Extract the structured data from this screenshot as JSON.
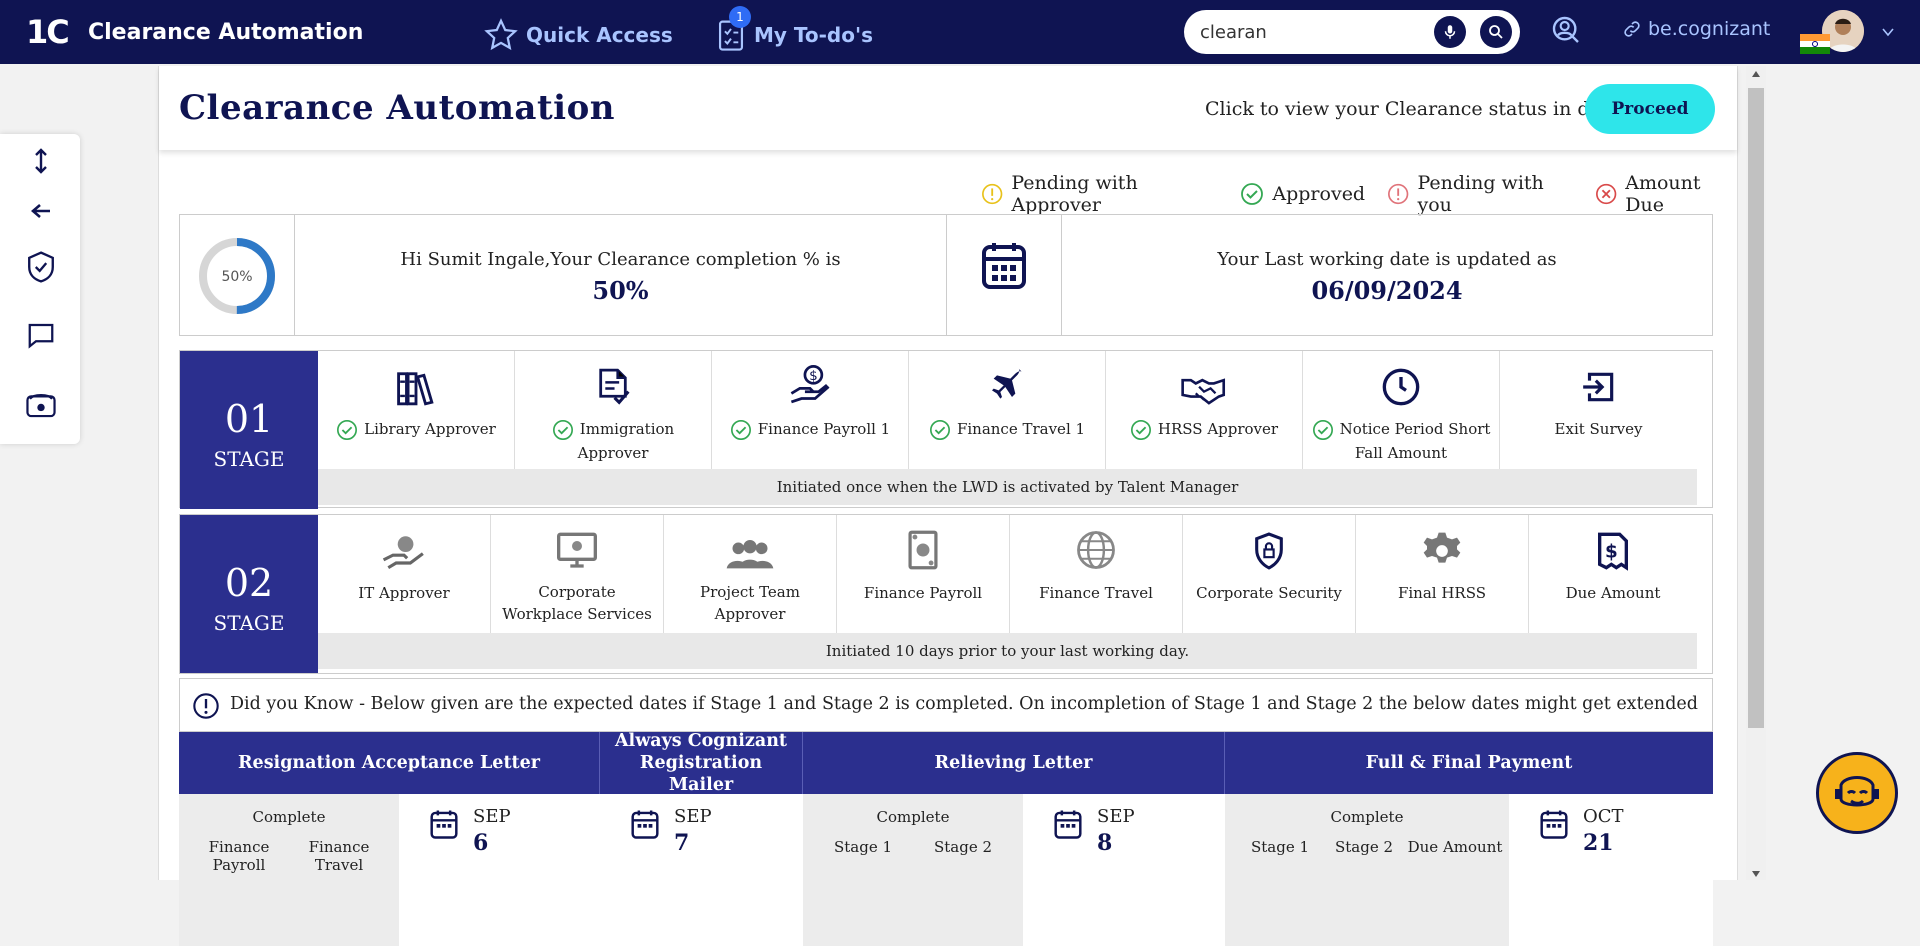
{
  "topbar": {
    "logo": "1C",
    "app_title": "Clearance Automation",
    "quick_access": "Quick Access",
    "todos": "My To-do's",
    "todo_count": "1",
    "search_value": "clearan",
    "link_label": "be.cognizant"
  },
  "page": {
    "title": "Clearance Automation",
    "detail_text": "Click to view your Clearance status in detail",
    "proceed": "Proceed"
  },
  "legend": {
    "pending_approver": "Pending with Approver",
    "approved": "Approved",
    "pending_you": "Pending with you",
    "amount_due": "Amount Due"
  },
  "status": {
    "progress_label": "50%",
    "progress_value": 0.5,
    "greeting": "Hi Sumit Ingale,Your Clearance completion % is",
    "completion": "50%",
    "lwd_text": "Your Last working date is updated as",
    "lwd_date": "06/09/2024"
  },
  "stage1": {
    "number": "01",
    "word": "STAGE",
    "note": "Initiated once when the LWD is activated by Talent Manager",
    "items": [
      {
        "label": "Library Approver",
        "icon": "books-icon",
        "approved": true
      },
      {
        "label": "Immigration Approver",
        "icon": "document-check-icon",
        "approved": true
      },
      {
        "label": "Finance Payroll 1",
        "icon": "money-hand-icon",
        "approved": true
      },
      {
        "label": "Finance Travel 1",
        "icon": "airplane-icon",
        "approved": true
      },
      {
        "label": "HRSS Approver",
        "icon": "handshake-icon",
        "approved": true
      },
      {
        "label": "Notice Period Short Fall Amount",
        "icon": "clock-icon",
        "approved": true
      },
      {
        "label": "Exit Survey",
        "icon": "exit-icon",
        "approved": false
      }
    ]
  },
  "stage2": {
    "number": "02",
    "word": "STAGE",
    "note": "Initiated 10 days prior to your last working day.",
    "items": [
      {
        "label": "IT Approver",
        "icon": "globe-hand-icon"
      },
      {
        "label": "Corporate Workplace Services",
        "icon": "monitor-icon"
      },
      {
        "label": "Project Team Approver",
        "icon": "team-icon"
      },
      {
        "label": "Finance Payroll",
        "icon": "cash-icon"
      },
      {
        "label": "Finance Travel",
        "icon": "globe-icon"
      },
      {
        "label": "Corporate Security",
        "icon": "shield-lock-icon"
      },
      {
        "label": "Final HRSS",
        "icon": "gear-icon"
      },
      {
        "label": "Due Amount",
        "icon": "invoice-dollar-icon"
      }
    ]
  },
  "info": {
    "text": "Did you Know - Below given are the expected dates if Stage 1 and Stage 2 is completed. On incompletion of Stage 1 and Stage 2 the below dates might get extended"
  },
  "documents": [
    {
      "title": "Resignation Acceptance Letter",
      "complete_label": "Complete",
      "requires": [
        "Finance Payroll",
        "Finance Travel"
      ],
      "month": "SEP",
      "day": "6"
    },
    {
      "title": "Always Cognizant Registration Mailer",
      "complete_label": "",
      "requires": [],
      "month": "SEP",
      "day": "7"
    },
    {
      "title": "Relieving Letter",
      "complete_label": "Complete",
      "requires": [
        "Stage 1",
        "Stage 2"
      ],
      "month": "SEP",
      "day": "8"
    },
    {
      "title": "Full & Final Payment",
      "complete_label": "Complete",
      "requires": [
        "Stage 1",
        "Stage 2",
        "Due Amount"
      ],
      "month": "OCT",
      "day": "21"
    }
  ]
}
